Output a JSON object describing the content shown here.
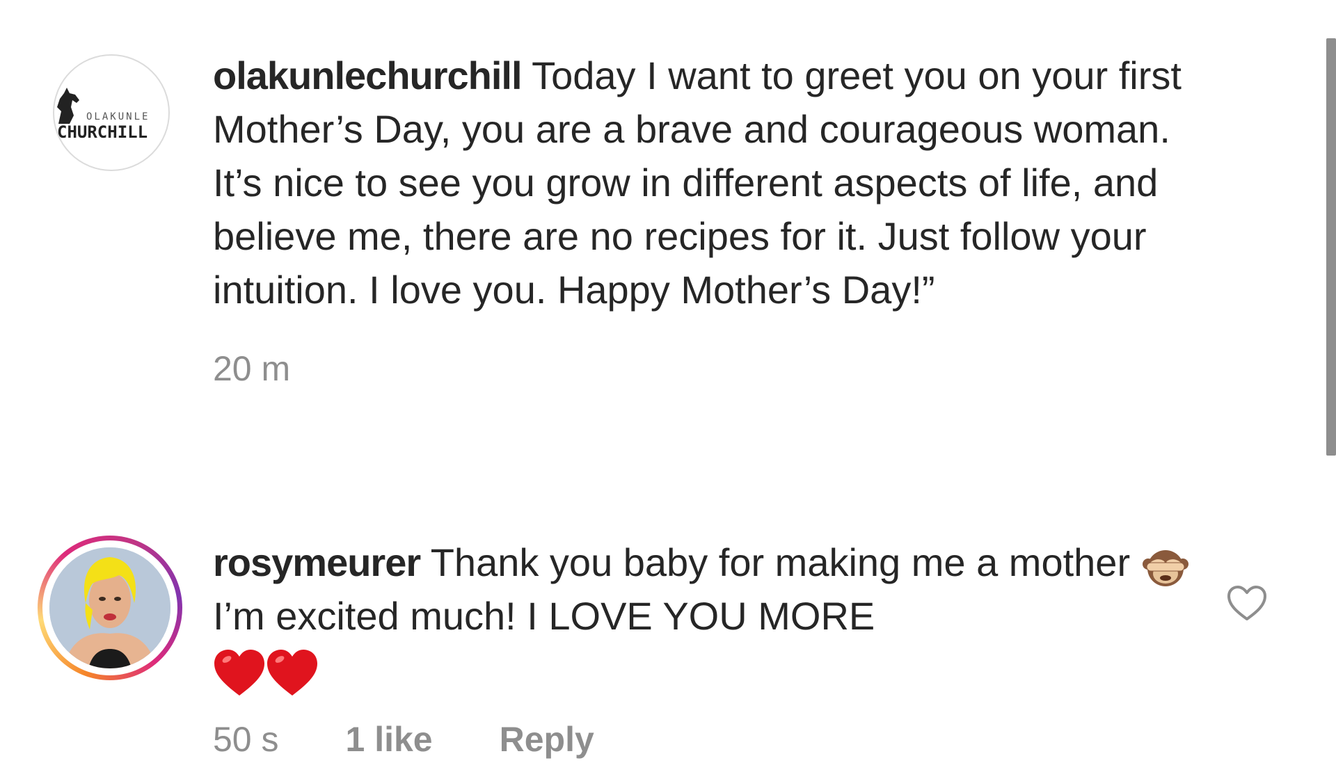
{
  "comments": [
    {
      "username": "olakunlechurchill",
      "avatar_logo_small": "OLAKUNLE",
      "avatar_logo_big": "CHURCHILL",
      "text": "Today I want to greet you on your first Mother’s Day, you are a brave and courageous woman. It’s nice to see you grow in different aspects of life, and believe me, there are no recipes for it. Just follow your intuition. I love you. Happy Mother’s Day!”",
      "time": "20 m"
    },
    {
      "username": "rosymeurer",
      "text_before_emoji": "Thank you baby for making me a mother",
      "emoji": "see-no-evil-monkey",
      "text_after_emoji": "I’m excited much! I LOVE YOU MORE",
      "trailing_emojis": [
        "red-heart",
        "red-heart"
      ],
      "time": "50 s",
      "likes": "1 like",
      "reply_label": "Reply",
      "story_ring_colors": [
        "#f58529",
        "#dd2a7b",
        "#8134af"
      ]
    }
  ],
  "accent_colors": {
    "text": "#262626",
    "meta": "#8e8e8e",
    "heart": "#e0141e"
  }
}
